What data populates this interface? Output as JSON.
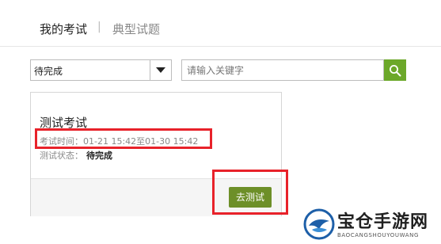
{
  "tabs": {
    "active": "我的考试",
    "separator": "|",
    "inactive": "典型试题"
  },
  "filter": {
    "selected": "待完成"
  },
  "search": {
    "placeholder": "请输入关键字"
  },
  "exam_card": {
    "title": "测试考试",
    "time_label": "考试时间：",
    "time_value": "01-21 15:42至01-30 15:42",
    "status_label": "测试状态：",
    "status_value": "待完成",
    "action_label": "去测试"
  },
  "watermark": {
    "name": "宝仓手游网",
    "sub": "BAOCANGSHOUYOUWANG"
  },
  "colors": {
    "accent_green": "#6ca82a",
    "button_green": "#6d8f28",
    "highlight_red": "#e8222a"
  }
}
